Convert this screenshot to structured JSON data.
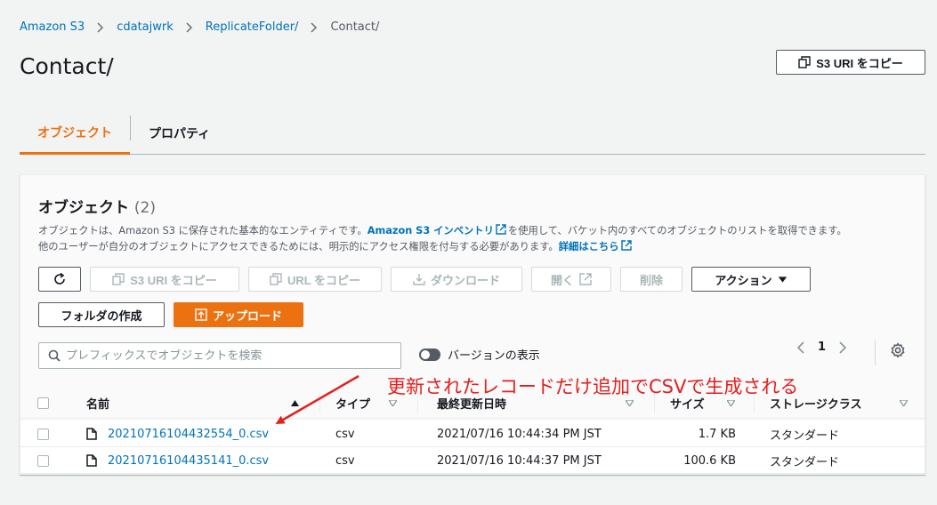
{
  "breadcrumb": {
    "items": [
      "Amazon S3",
      "cdatajwrk",
      "ReplicateFolder/",
      "Contact/"
    ]
  },
  "page": {
    "title": "Contact/",
    "copy_uri_button": "S3 URI をコピー"
  },
  "tabs": [
    {
      "label": "オブジェクト",
      "active": true
    },
    {
      "label": "プロパティ",
      "active": false
    }
  ],
  "objects_panel": {
    "title": "オブジェクト",
    "count": "(2)",
    "desc_line1_a": "オブジェクトは、Amazon S3 に保存された基本的なエンティティです。",
    "desc_line1_link": "Amazon S3 インベントリ",
    "desc_line1_b": "を使用して、バケット内のすべてのオブジェクトのリストを取得できます。",
    "desc_line2_a": "他のユーザーが自分のオブジェクトにアクセスできるためには、明示的にアクセス権限を付与する必要があります。",
    "desc_line2_link": "詳細はこちら"
  },
  "toolbar": {
    "copy_s3_uri": "S3 URI をコピー",
    "copy_url": "URL をコピー",
    "download": "ダウンロード",
    "open": "開く",
    "delete": "削除",
    "actions": "アクション",
    "create_folder": "フォルダの作成",
    "upload": "アップロード"
  },
  "search": {
    "placeholder": "プレフィックスでオブジェクトを検索"
  },
  "versions_toggle": {
    "label": "バージョンの表示",
    "on": false
  },
  "pagination": {
    "current_page": "1"
  },
  "annotation": {
    "text": "更新されたレコードだけ追加でCSVで生成される",
    "color": "#e3201e"
  },
  "table": {
    "columns": [
      "名前",
      "タイプ",
      "最終更新日時",
      "サイズ",
      "ストレージクラス"
    ],
    "rows": [
      {
        "name": "20210716104432554_0.csv",
        "type": "csv",
        "modified": "2021/07/16 10:44:34 PM JST",
        "size": "1.7 KB",
        "storage": "スタンダード"
      },
      {
        "name": "20210716104435141_0.csv",
        "type": "csv",
        "modified": "2021/07/16 10:44:37 PM JST",
        "size": "100.6 KB",
        "storage": "スタンダード"
      }
    ]
  },
  "colors": {
    "accent": "#ec7211",
    "link": "#0073bb"
  }
}
